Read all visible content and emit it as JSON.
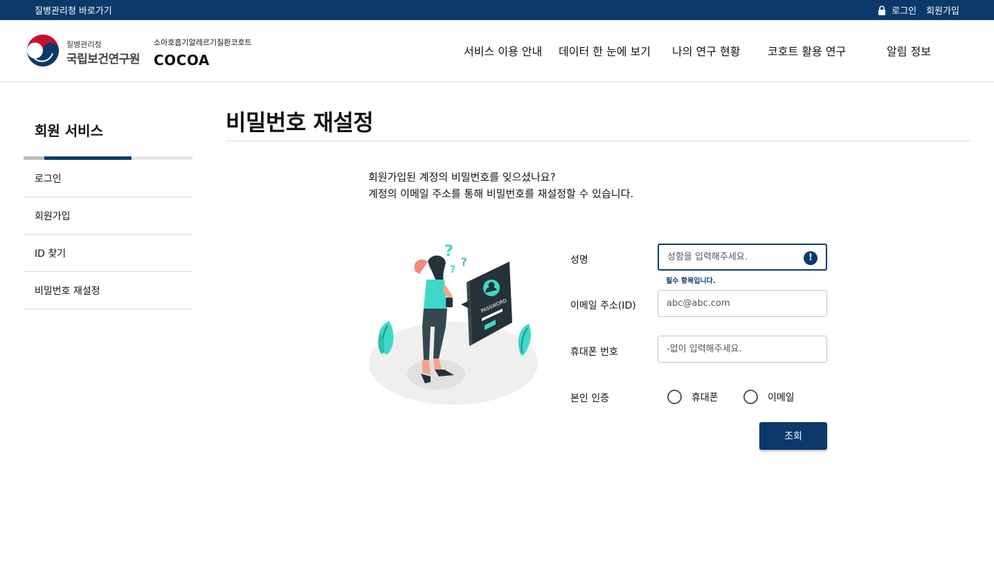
{
  "topbar": {
    "kdca_link": "질병관리청 바로가기",
    "login": "로그인",
    "join": "회원가입"
  },
  "header": {
    "institute_small": "질병관리청",
    "institute_name": "국립보건연구원",
    "cohort_name": "소아호흡기알레르기질환코호트",
    "brand": "COCOA",
    "nav": [
      "서비스 이용 안내",
      "데이터 한 눈에 보기",
      "나의 연구 현황",
      "코호트 활용 연구",
      "알림 정보"
    ]
  },
  "sidebar": {
    "title": "회원 서비스",
    "items": [
      "로그인",
      "회원가입",
      "ID 찾기",
      "비밀번호 재설정"
    ]
  },
  "main": {
    "title": "비밀번호 재설정",
    "intro_line1": "회원가입된 계정의 비밀번호를 잊으셨나요?",
    "intro_line2": "계정의 이메일 주소를 통해 비밀번호를 재설정할 수 있습니다.",
    "illustration_label": "PASSWORD"
  },
  "form": {
    "name_label": "성명",
    "name_placeholder": "성함을 입력해주세요.",
    "required_msg": "필수 항목입니다.",
    "email_label": "이메일 주소(ID)",
    "email_placeholder": "abc@abc.com",
    "phone_label": "휴대폰 번호",
    "phone_placeholder": "-없이 입력해주세요.",
    "verify_label": "본인 인증",
    "verify_options": [
      "휴대폰",
      "이메일"
    ],
    "submit": "조회"
  },
  "colors": {
    "primary": "#0b3a6a",
    "accent": "#3fd8c8"
  }
}
